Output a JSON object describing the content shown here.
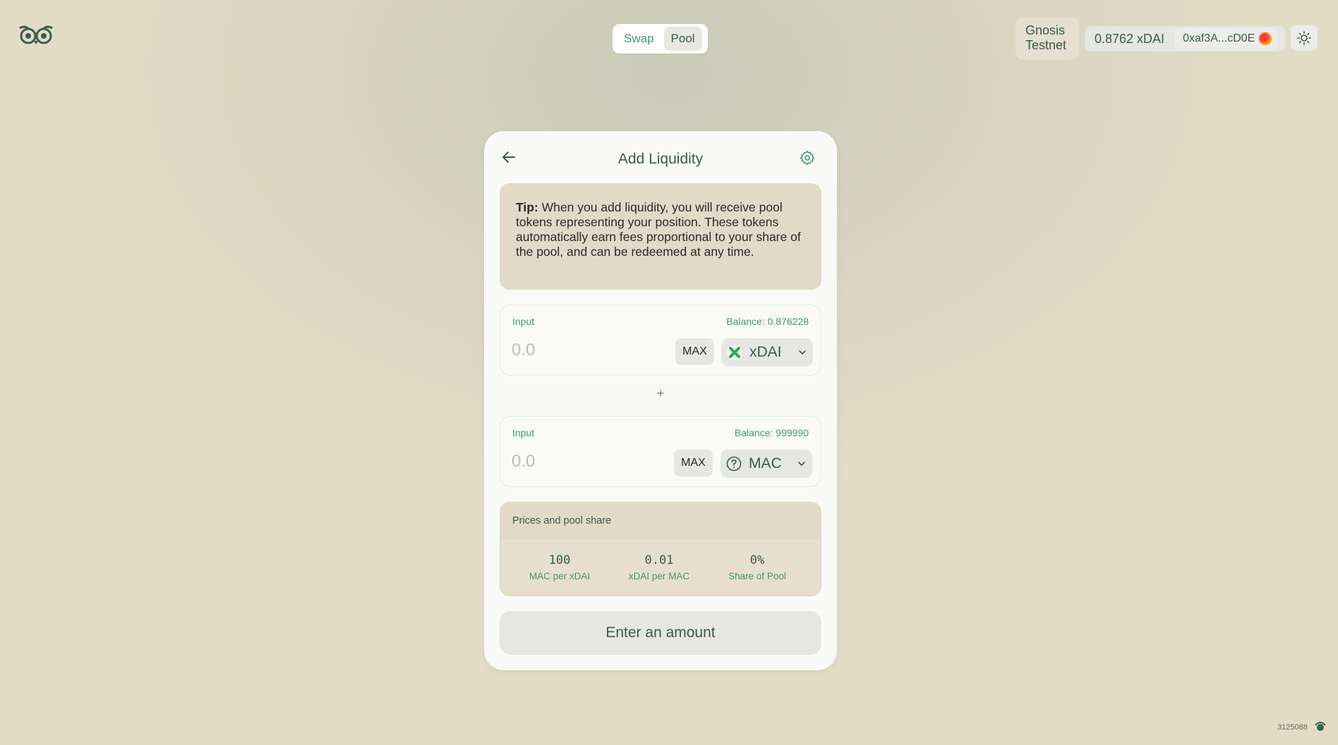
{
  "header": {
    "nav_tabs": [
      {
        "label": "Swap",
        "active": false
      },
      {
        "label": "Pool",
        "active": true
      }
    ],
    "network": {
      "line1": "Gnosis",
      "line2": "Testnet"
    },
    "wallet": {
      "balance": "0.8762 xDAI",
      "address": "0xaf3A...cD0E"
    }
  },
  "card": {
    "title": "Add Liquidity",
    "tip": {
      "bold": "Tip:",
      "text": " When you add liquidity, you will receive pool tokens representing your position. These tokens automatically earn fees proportional to your share of the pool, and can be redeemed at any time."
    },
    "input_a": {
      "label": "Input",
      "balance": "Balance: 0.876228",
      "placeholder": "0.0",
      "max_label": "MAX",
      "token": "xDAI"
    },
    "plus": "+",
    "input_b": {
      "label": "Input",
      "balance": "Balance: 999990",
      "placeholder": "0.0",
      "max_label": "MAX",
      "token": "MAC"
    },
    "prices": {
      "title": "Prices and pool share",
      "items": [
        {
          "value": "100",
          "label": "MAC per xDAI"
        },
        {
          "value": "0.01",
          "label": "xDAI per MAC"
        },
        {
          "value": "0%",
          "label": "Share of Pool"
        }
      ]
    },
    "submit_label": "Enter an amount"
  },
  "footer": {
    "block_number": "3125088"
  },
  "colors": {
    "accent": "#3d9a6a",
    "text": "#3c5a4c",
    "tip_bg": "#e2dac6"
  }
}
